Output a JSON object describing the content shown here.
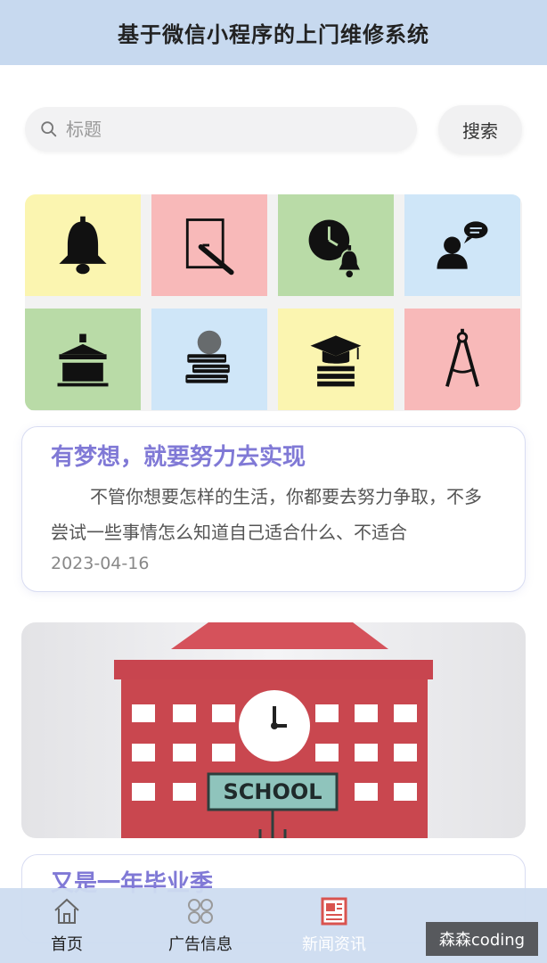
{
  "header": {
    "title": "基于微信小程序的上门维修系统"
  },
  "search": {
    "placeholder": "标题",
    "button_label": "搜索"
  },
  "menu_tiles": [
    {
      "icon": "bell-icon",
      "color": "#fbf5b0"
    },
    {
      "icon": "drawing-board-icon",
      "color": "#f8b9b9"
    },
    {
      "icon": "clock-bell-icon",
      "color": "#b9dba7"
    },
    {
      "icon": "speaker-icon",
      "color": "#cfe6f8"
    },
    {
      "icon": "podium-icon",
      "color": "#b9dba7"
    },
    {
      "icon": "books-icon",
      "color": "#cfe6f8"
    },
    {
      "icon": "graduation-books-icon",
      "color": "#fbf5b0"
    },
    {
      "icon": "compass-icon",
      "color": "#f8b9b9"
    }
  ],
  "news": [
    {
      "title": "有梦想，就要努力去实现",
      "summary": "不管你想要怎样的生活，你都要去努力争取，不多尝试一些事情怎么知道自己适合什么、不适合",
      "date": "2023-04-16"
    },
    {
      "title": "又是一年毕业季"
    }
  ],
  "banner": {
    "sign_text": "SCHOOL"
  },
  "tabbar": {
    "items": [
      {
        "label": "首页",
        "icon": "home-icon"
      },
      {
        "label": "广告信息",
        "icon": "grid-icon"
      },
      {
        "label": "新闻资讯",
        "icon": "newspaper-icon"
      },
      {
        "label": "",
        "icon": ""
      }
    ],
    "active_color": "#d9534f"
  },
  "watermark": "森森coding"
}
